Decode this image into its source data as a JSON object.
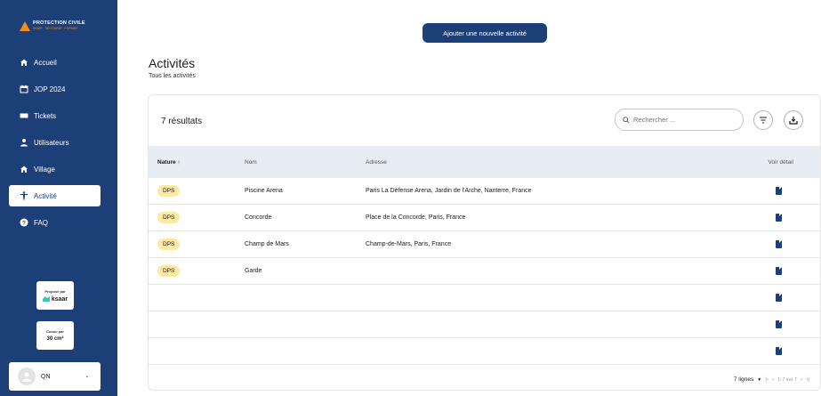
{
  "sidebar": {
    "logo_title": "PROTECTION CIVILE",
    "logo_tagline": "AIDER · SECOURIR · FORMER",
    "items": [
      {
        "label": "Accueil",
        "icon": "home-icon"
      },
      {
        "label": "JOP 2024",
        "icon": "calendar-icon"
      },
      {
        "label": "Tickets",
        "icon": "ticket-icon"
      },
      {
        "label": "Utilisateurs",
        "icon": "user-icon"
      },
      {
        "label": "Village",
        "icon": "home-icon"
      },
      {
        "label": "Activité",
        "icon": "person-icon",
        "active": true
      },
      {
        "label": "FAQ",
        "icon": "help-icon"
      }
    ],
    "partners": [
      {
        "caption": "Proposé par",
        "name": "ksaar"
      },
      {
        "caption": "Conçu par",
        "name": "30 cm²"
      }
    ],
    "user": {
      "initials": "QN"
    }
  },
  "header": {
    "add_button": "Ajouter une nouvelle activité",
    "title": "Activités",
    "subtitle": "Tous les activités"
  },
  "table": {
    "results": "7 résultats",
    "search_placeholder": "Rechercher ...",
    "columns": [
      "Nature ↑",
      "Nom",
      "Adresse",
      "Voir détail"
    ],
    "rows": [
      {
        "nature": "DPS",
        "nom": "Piscine Arena",
        "adresse": "Paris La Défense Arena, Jardin de l'Arche, Nanterre, France"
      },
      {
        "nature": "DPS",
        "nom": "Concorde",
        "adresse": "Place de la Concorde, Paris, France"
      },
      {
        "nature": "DPS",
        "nom": "Champ de Mars",
        "adresse": "Champ-de-Mars, Paris, France"
      },
      {
        "nature": "DPS",
        "nom": "Garde",
        "adresse": ""
      },
      {
        "nature": "",
        "nom": "",
        "adresse": ""
      },
      {
        "nature": "",
        "nom": "",
        "adresse": ""
      },
      {
        "nature": "",
        "nom": "",
        "adresse": ""
      }
    ],
    "pagination": {
      "rows_label": "7 lignes",
      "range": "1-7 sur 7"
    }
  },
  "colors": {
    "brand": "#1d3f78",
    "accent": "#f28c1a",
    "badge": "#fde8a6"
  }
}
